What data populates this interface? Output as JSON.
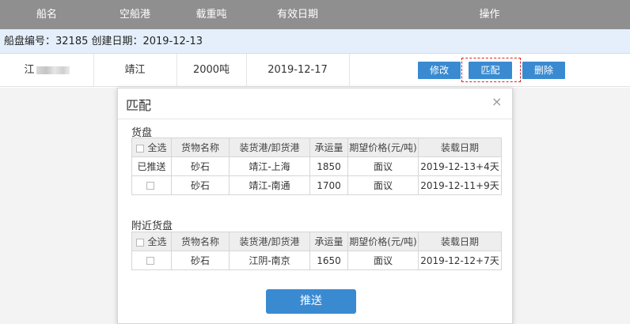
{
  "header": {
    "col_ship_name": "船名",
    "col_empty_port": "空船港",
    "col_load_tons": "载重吨",
    "col_valid_date": "有效日期",
    "col_actions": "操作"
  },
  "info_bar": {
    "text": "船盘编号：32185 创建日期：2019-12-13"
  },
  "row": {
    "ship_name": "江",
    "empty_port": "靖江",
    "load_tons": "2000吨",
    "valid_date": "2019-12-17",
    "edit_label": "修改",
    "match_label": "匹配",
    "delete_label": "删除"
  },
  "modal": {
    "title": "匹配",
    "close_icon": "×",
    "cargo_section": {
      "title": "货盘",
      "columns": [
        "全选",
        "货物名称",
        "装货港/卸货港",
        "承运量",
        "期望价格(元/吨)",
        "装载日期"
      ],
      "rows": [
        {
          "status": "已推送",
          "name": "砂石",
          "route": "靖江-上海",
          "volume": "1850",
          "price": "面议",
          "date": "2019-12-13+4天"
        },
        {
          "status": "",
          "name": "砂石",
          "route": "靖江-南通",
          "volume": "1700",
          "price": "面议",
          "date": "2019-12-11+9天"
        }
      ]
    },
    "nearby_section": {
      "title": "附近货盘",
      "columns": [
        "全选",
        "货物名称",
        "装货港/卸货港",
        "承运量",
        "期望价格(元/吨)",
        "装载日期"
      ],
      "rows": [
        {
          "status": "",
          "name": "砂石",
          "route": "江阴-南京",
          "volume": "1650",
          "price": "面议",
          "date": "2019-12-12+7天"
        }
      ]
    },
    "push_label": "推送"
  },
  "colors": {
    "header_bg": "#8f8f8f",
    "info_bg": "#e4effb",
    "button": "#3a8ad1",
    "pushed": "#e84b3c",
    "focus_ring": "#e2231a"
  }
}
